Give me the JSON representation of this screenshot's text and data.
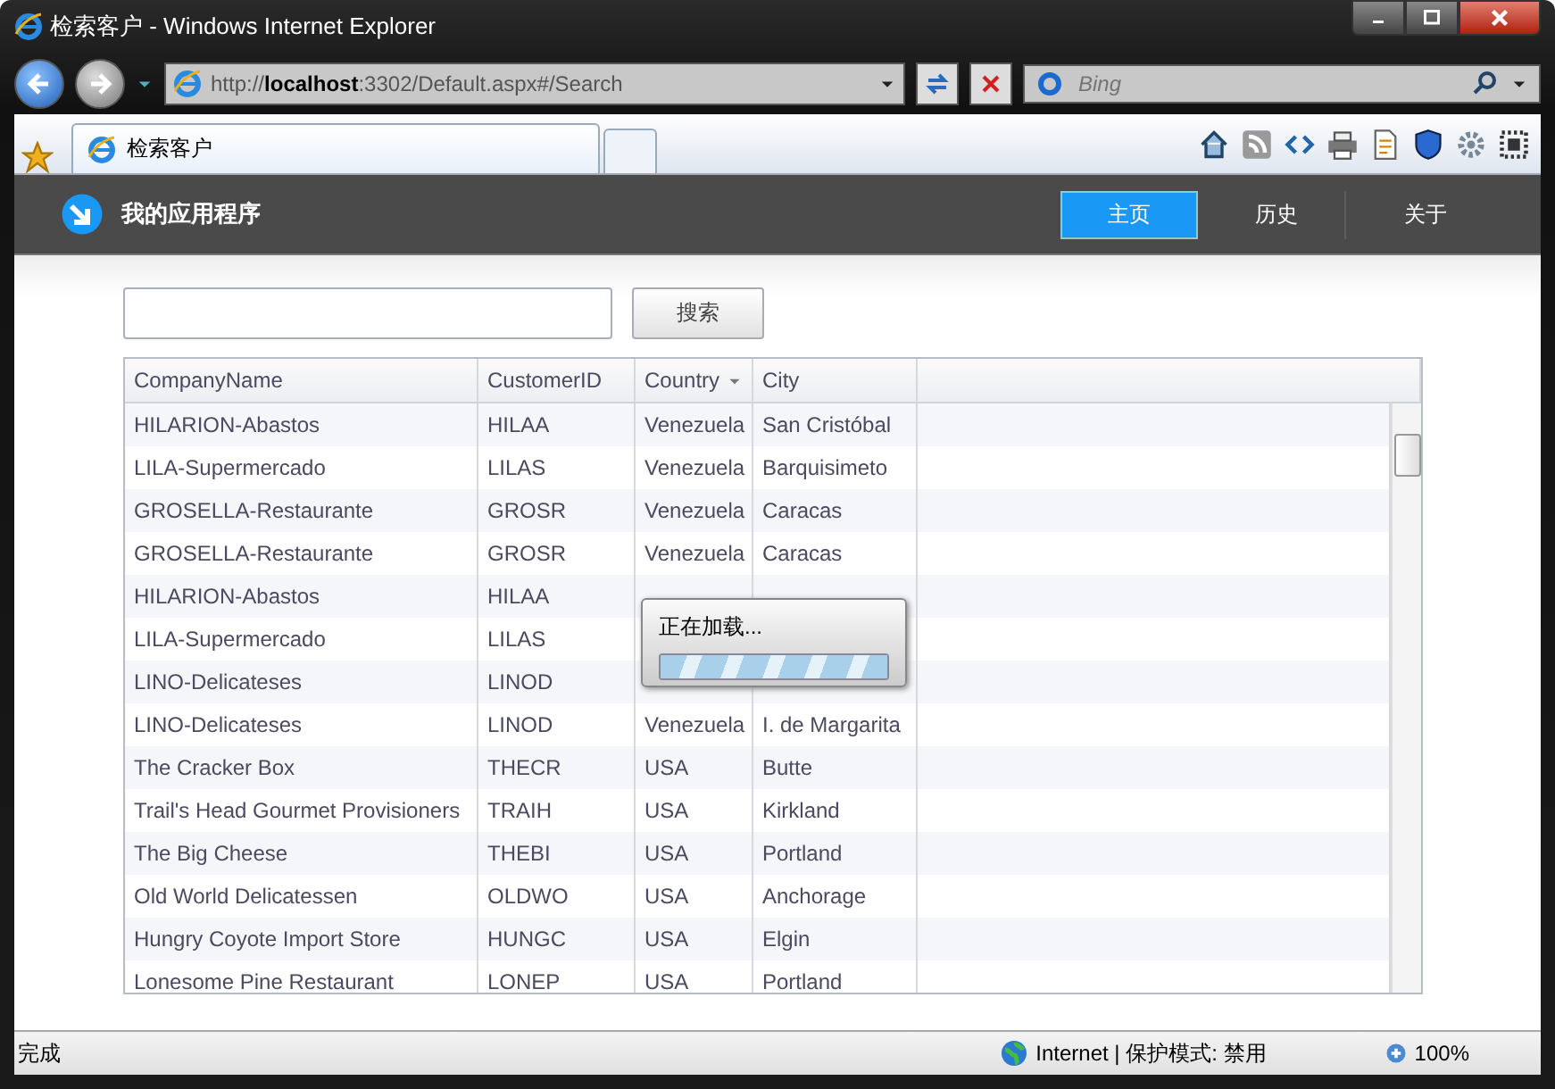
{
  "window": {
    "title": "检索客户 - Windows Internet Explorer"
  },
  "address_bar": {
    "url": "http://**localhost**:3302/Default.aspx#/Search"
  },
  "search_box": {
    "placeholder": "Bing"
  },
  "tabs": [
    {
      "label": "检索客户",
      "selected": true
    }
  ],
  "app": {
    "title": "我的应用程序",
    "nav": [
      {
        "label": "主页",
        "selected": true
      },
      {
        "label": "历史",
        "selected": false
      },
      {
        "label": "关于",
        "selected": false
      }
    ]
  },
  "search": {
    "button": "搜索"
  },
  "table": {
    "columns": [
      {
        "label": "CompanyName",
        "sorted": false
      },
      {
        "label": "CustomerID",
        "sorted": false
      },
      {
        "label": "Country",
        "sorted": true
      },
      {
        "label": "City",
        "sorted": false
      }
    ],
    "rows": [
      {
        "cells": [
          "HILARION-Abastos",
          "HILAA",
          "Venezuela",
          "San Cristóbal"
        ]
      },
      {
        "cells": [
          "LILA-Supermercado",
          "LILAS",
          "Venezuela",
          "Barquisimeto"
        ]
      },
      {
        "cells": [
          "GROSELLA-Restaurante",
          "GROSR",
          "Venezuela",
          "Caracas"
        ]
      },
      {
        "cells": [
          "GROSELLA-Restaurante",
          "GROSR",
          "Venezuela",
          "Caracas"
        ]
      },
      {
        "cells": [
          "HILARION-Abastos",
          "HILAA"
        ]
      },
      {
        "cells": [
          "LILA-Supermercado",
          "LILAS"
        ]
      },
      {
        "cells": [
          "LINO-Delicateses",
          "LINOD"
        ]
      },
      {
        "cells": [
          "LINO-Delicateses",
          "LINOD",
          "Venezuela",
          "I. de Margarita"
        ]
      },
      {
        "cells": [
          "The Cracker Box",
          "THECR",
          "USA",
          "Butte"
        ]
      },
      {
        "cells": [
          "Trail's Head Gourmet Provisioners",
          "TRAIH",
          "USA",
          "Kirkland"
        ]
      },
      {
        "cells": [
          "The Big Cheese",
          "THEBI",
          "USA",
          "Portland"
        ]
      },
      {
        "cells": [
          "Old World Delicatessen",
          "OLDWO",
          "USA",
          "Anchorage"
        ]
      },
      {
        "cells": [
          "Hungry Coyote Import Store",
          "HUNGC",
          "USA",
          "Elgin"
        ]
      },
      {
        "cells": [
          "Lonesome Pine Restaurant",
          "LONEP",
          "USA",
          "Portland"
        ]
      }
    ]
  },
  "loading": {
    "text": "正在加载...",
    "level": 1
  },
  "status_bar": {
    "text": "完成",
    "zone": "Internet | 保护模式: 禁用",
    "zoom": "100%"
  }
}
